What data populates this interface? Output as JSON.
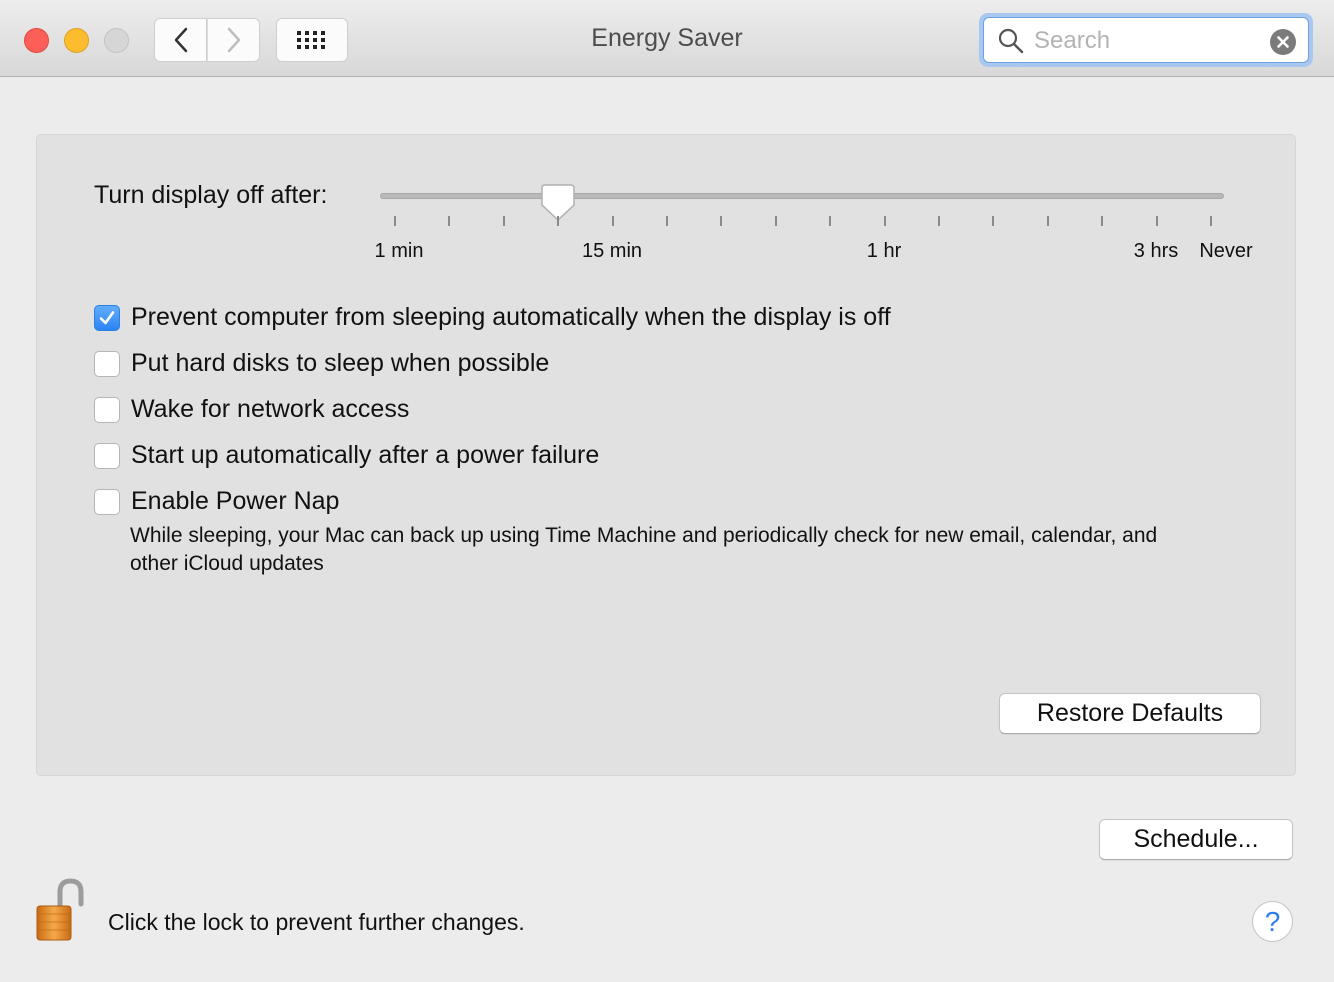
{
  "window": {
    "title": "Energy Saver"
  },
  "toolbar": {
    "back_icon": "chevron-left-icon",
    "forward_icon": "chevron-right-icon",
    "show_all_icon": "grid-icon"
  },
  "search": {
    "placeholder": "Search",
    "value": ""
  },
  "display_sleep": {
    "label": "Turn display off after:",
    "selected_minutes": 10,
    "tick_labels": {
      "min1": "1 min",
      "min15": "15 min",
      "hr1": "1 hr",
      "hrs3": "3 hrs",
      "never": "Never"
    }
  },
  "options": [
    {
      "label": "Prevent computer from sleeping automatically when the display is off",
      "checked": true
    },
    {
      "label": "Put hard disks to sleep when possible",
      "checked": false
    },
    {
      "label": "Wake for network access",
      "checked": false
    },
    {
      "label": "Start up automatically after a power failure",
      "checked": false
    },
    {
      "label": "Enable Power Nap",
      "checked": false
    }
  ],
  "power_nap_description": "While sleeping, your Mac can back up using Time Machine and periodically check for new email, calendar, and other iCloud updates",
  "buttons": {
    "restore_defaults": "Restore Defaults",
    "schedule": "Schedule...",
    "help": "?"
  },
  "lock": {
    "icon": "unlocked-padlock-icon",
    "text": "Click the lock to prevent further changes."
  },
  "colors": {
    "accent": "#2b84f3",
    "close": "#fc5f57",
    "minimize": "#fdbc2e"
  }
}
